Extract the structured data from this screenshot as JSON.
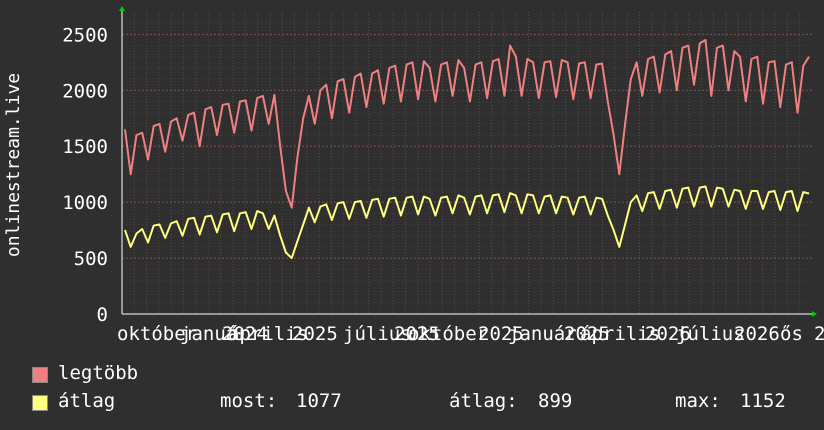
{
  "chart_data": {
    "type": "line",
    "ylabel": "onlinestream.live",
    "ylim": [
      0,
      2700
    ],
    "yticks": [
      0,
      500,
      1000,
      1500,
      2000,
      2500
    ],
    "xtick_labels": [
      "október",
      "január",
      "2024",
      "április",
      "2025",
      "július",
      "2025",
      "október",
      "2025",
      "január",
      "2025",
      "április",
      "2026",
      "július",
      "2026",
      "ős",
      "2"
    ],
    "grid": true,
    "series": [
      {
        "name": "legtöbb",
        "color": "#f08080",
        "points": [
          [
            0,
            1650
          ],
          [
            1,
            1250
          ],
          [
            2,
            1600
          ],
          [
            3,
            1620
          ],
          [
            4,
            1380
          ],
          [
            5,
            1680
          ],
          [
            6,
            1700
          ],
          [
            7,
            1450
          ],
          [
            8,
            1720
          ],
          [
            9,
            1750
          ],
          [
            10,
            1550
          ],
          [
            11,
            1780
          ],
          [
            12,
            1800
          ],
          [
            13,
            1500
          ],
          [
            14,
            1830
          ],
          [
            15,
            1850
          ],
          [
            16,
            1600
          ],
          [
            17,
            1870
          ],
          [
            18,
            1880
          ],
          [
            19,
            1620
          ],
          [
            20,
            1900
          ],
          [
            21,
            1910
          ],
          [
            22,
            1640
          ],
          [
            23,
            1930
          ],
          [
            24,
            1950
          ],
          [
            25,
            1700
          ],
          [
            26,
            1960
          ],
          [
            27,
            1500
          ],
          [
            28,
            1100
          ],
          [
            29,
            950
          ],
          [
            30,
            1400
          ],
          [
            31,
            1750
          ],
          [
            32,
            1950
          ],
          [
            33,
            1700
          ],
          [
            34,
            2000
          ],
          [
            35,
            2050
          ],
          [
            36,
            1750
          ],
          [
            37,
            2080
          ],
          [
            38,
            2100
          ],
          [
            39,
            1800
          ],
          [
            40,
            2120
          ],
          [
            41,
            2150
          ],
          [
            42,
            1850
          ],
          [
            43,
            2150
          ],
          [
            44,
            2180
          ],
          [
            45,
            1880
          ],
          [
            46,
            2200
          ],
          [
            47,
            2220
          ],
          [
            48,
            1900
          ],
          [
            49,
            2230
          ],
          [
            50,
            2250
          ],
          [
            51,
            1920
          ],
          [
            52,
            2260
          ],
          [
            53,
            2200
          ],
          [
            54,
            1900
          ],
          [
            55,
            2230
          ],
          [
            56,
            2250
          ],
          [
            57,
            1950
          ],
          [
            58,
            2270
          ],
          [
            59,
            2200
          ],
          [
            60,
            1900
          ],
          [
            61,
            2230
          ],
          [
            62,
            2250
          ],
          [
            63,
            1930
          ],
          [
            64,
            2260
          ],
          [
            65,
            2280
          ],
          [
            66,
            1950
          ],
          [
            67,
            2400
          ],
          [
            68,
            2300
          ],
          [
            69,
            1950
          ],
          [
            70,
            2280
          ],
          [
            71,
            2250
          ],
          [
            72,
            1930
          ],
          [
            73,
            2250
          ],
          [
            74,
            2260
          ],
          [
            75,
            1940
          ],
          [
            76,
            2270
          ],
          [
            77,
            2250
          ],
          [
            78,
            1920
          ],
          [
            79,
            2240
          ],
          [
            80,
            2250
          ],
          [
            81,
            1930
          ],
          [
            82,
            2230
          ],
          [
            83,
            2240
          ],
          [
            84,
            1900
          ],
          [
            85,
            1600
          ],
          [
            86,
            1250
          ],
          [
            87,
            1700
          ],
          [
            88,
            2100
          ],
          [
            89,
            2250
          ],
          [
            90,
            1950
          ],
          [
            91,
            2280
          ],
          [
            92,
            2300
          ],
          [
            93,
            1980
          ],
          [
            94,
            2320
          ],
          [
            95,
            2350
          ],
          [
            96,
            2000
          ],
          [
            97,
            2380
          ],
          [
            98,
            2400
          ],
          [
            99,
            2050
          ],
          [
            100,
            2420
          ],
          [
            101,
            2450
          ],
          [
            102,
            1950
          ],
          [
            103,
            2380
          ],
          [
            104,
            2400
          ],
          [
            105,
            2000
          ],
          [
            106,
            2350
          ],
          [
            107,
            2300
          ],
          [
            108,
            1900
          ],
          [
            109,
            2280
          ],
          [
            110,
            2300
          ],
          [
            111,
            1880
          ],
          [
            112,
            2250
          ],
          [
            113,
            2260
          ],
          [
            114,
            1850
          ],
          [
            115,
            2230
          ],
          [
            116,
            2250
          ],
          [
            117,
            1800
          ],
          [
            118,
            2220
          ],
          [
            119,
            2300
          ]
        ]
      },
      {
        "name": "átlag",
        "color": "#ffff80",
        "points": [
          [
            0,
            750
          ],
          [
            1,
            600
          ],
          [
            2,
            720
          ],
          [
            3,
            760
          ],
          [
            4,
            640
          ],
          [
            5,
            790
          ],
          [
            6,
            800
          ],
          [
            7,
            680
          ],
          [
            8,
            810
          ],
          [
            9,
            830
          ],
          [
            10,
            700
          ],
          [
            11,
            850
          ],
          [
            12,
            860
          ],
          [
            13,
            710
          ],
          [
            14,
            870
          ],
          [
            15,
            880
          ],
          [
            16,
            730
          ],
          [
            17,
            890
          ],
          [
            18,
            900
          ],
          [
            19,
            740
          ],
          [
            20,
            900
          ],
          [
            21,
            910
          ],
          [
            22,
            760
          ],
          [
            23,
            920
          ],
          [
            24,
            900
          ],
          [
            25,
            760
          ],
          [
            26,
            880
          ],
          [
            27,
            700
          ],
          [
            28,
            550
          ],
          [
            29,
            500
          ],
          [
            30,
            650
          ],
          [
            31,
            800
          ],
          [
            32,
            950
          ],
          [
            33,
            820
          ],
          [
            34,
            960
          ],
          [
            35,
            980
          ],
          [
            36,
            840
          ],
          [
            37,
            990
          ],
          [
            38,
            1000
          ],
          [
            39,
            850
          ],
          [
            40,
            1000
          ],
          [
            41,
            1010
          ],
          [
            42,
            860
          ],
          [
            43,
            1020
          ],
          [
            44,
            1030
          ],
          [
            45,
            870
          ],
          [
            46,
            1030
          ],
          [
            47,
            1040
          ],
          [
            48,
            880
          ],
          [
            49,
            1040
          ],
          [
            50,
            1050
          ],
          [
            51,
            890
          ],
          [
            52,
            1050
          ],
          [
            53,
            1030
          ],
          [
            54,
            880
          ],
          [
            55,
            1040
          ],
          [
            56,
            1050
          ],
          [
            57,
            900
          ],
          [
            58,
            1060
          ],
          [
            59,
            1040
          ],
          [
            60,
            890
          ],
          [
            61,
            1050
          ],
          [
            62,
            1060
          ],
          [
            63,
            900
          ],
          [
            64,
            1060
          ],
          [
            65,
            1070
          ],
          [
            66,
            910
          ],
          [
            67,
            1080
          ],
          [
            68,
            1060
          ],
          [
            69,
            900
          ],
          [
            70,
            1070
          ],
          [
            71,
            1060
          ],
          [
            72,
            900
          ],
          [
            73,
            1050
          ],
          [
            74,
            1060
          ],
          [
            75,
            900
          ],
          [
            76,
            1050
          ],
          [
            77,
            1040
          ],
          [
            78,
            890
          ],
          [
            79,
            1040
          ],
          [
            80,
            1050
          ],
          [
            81,
            890
          ],
          [
            82,
            1040
          ],
          [
            83,
            1030
          ],
          [
            84,
            880
          ],
          [
            85,
            750
          ],
          [
            86,
            600
          ],
          [
            87,
            800
          ],
          [
            88,
            1000
          ],
          [
            89,
            1060
          ],
          [
            90,
            920
          ],
          [
            91,
            1080
          ],
          [
            92,
            1090
          ],
          [
            93,
            940
          ],
          [
            94,
            1100
          ],
          [
            95,
            1110
          ],
          [
            96,
            950
          ],
          [
            97,
            1120
          ],
          [
            98,
            1130
          ],
          [
            99,
            960
          ],
          [
            100,
            1130
          ],
          [
            101,
            1140
          ],
          [
            102,
            960
          ],
          [
            103,
            1130
          ],
          [
            104,
            1120
          ],
          [
            105,
            960
          ],
          [
            106,
            1110
          ],
          [
            107,
            1100
          ],
          [
            108,
            940
          ],
          [
            109,
            1100
          ],
          [
            110,
            1100
          ],
          [
            111,
            940
          ],
          [
            112,
            1090
          ],
          [
            113,
            1100
          ],
          [
            114,
            930
          ],
          [
            115,
            1090
          ],
          [
            116,
            1100
          ],
          [
            117,
            920
          ],
          [
            118,
            1090
          ],
          [
            119,
            1077
          ]
        ]
      }
    ]
  },
  "legend": {
    "items": [
      {
        "label": "legtöbb",
        "color": "#f08080"
      },
      {
        "label": "átlag",
        "color": "#ffff80"
      }
    ],
    "stats": {
      "most_label": "most:",
      "most_value": "1077",
      "avg_label": "átlag:",
      "avg_value": "899",
      "max_label": "max:",
      "max_value": "1152"
    }
  }
}
